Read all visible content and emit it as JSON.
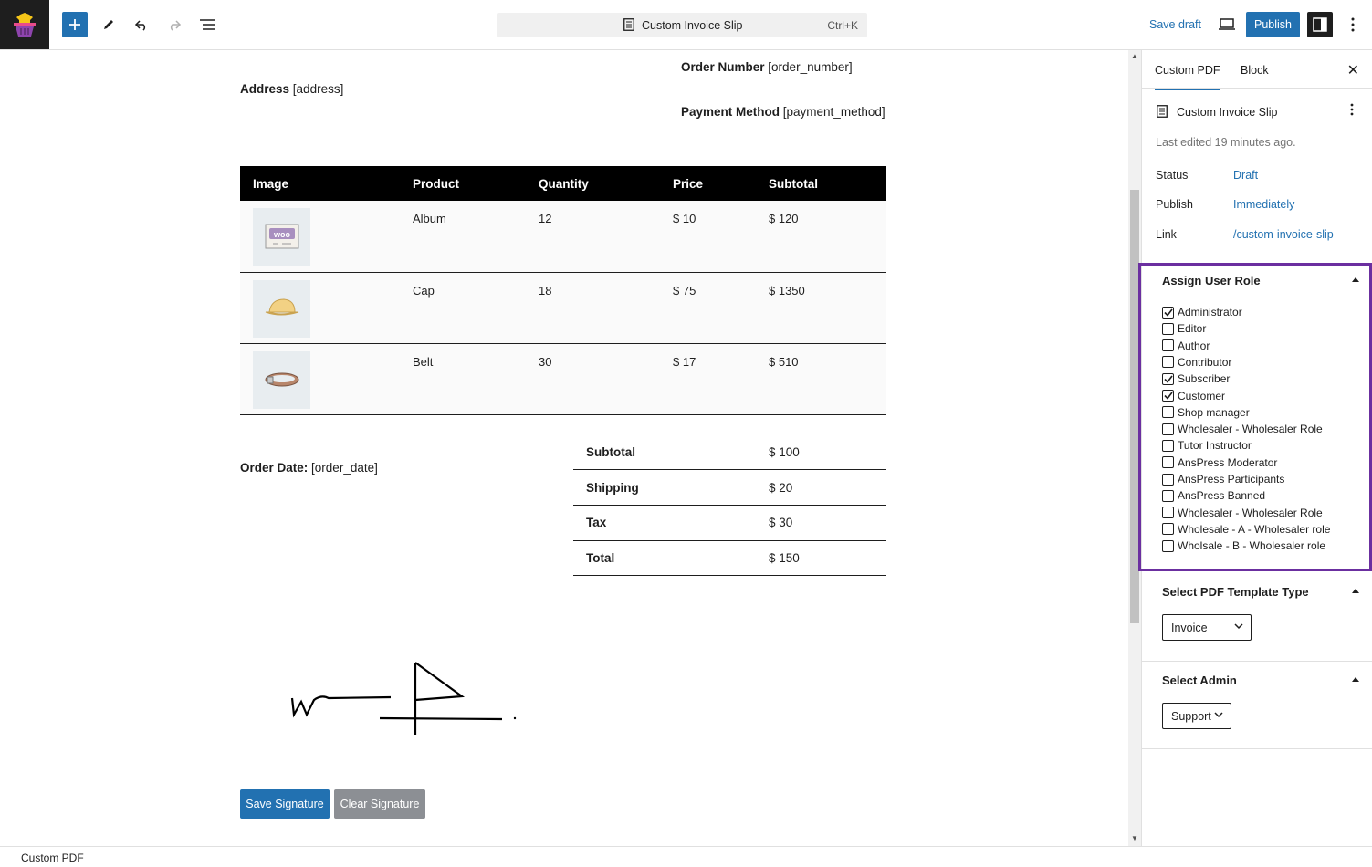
{
  "topbar": {
    "document_title": "Custom Invoice Slip",
    "shortcut": "Ctrl+K",
    "save_draft": "Save draft",
    "publish": "Publish"
  },
  "document": {
    "order_number_label": "Order Number",
    "order_number_value": "[order_number]",
    "address_label": "Address",
    "address_value": "[address]",
    "payment_method_label": "Payment Method",
    "payment_method_value": "[payment_method]",
    "order_date_label": "Order Date:",
    "order_date_value": "[order_date]",
    "table_headers": [
      "Image",
      "Product",
      "Quantity",
      "Price",
      "Subtotal"
    ],
    "items": [
      {
        "product": "Album",
        "quantity": "12",
        "price": "$ 10",
        "subtotal": "$ 120",
        "image": "woo-album-icon"
      },
      {
        "product": "Cap",
        "quantity": "18",
        "price": "$ 75",
        "subtotal": "$ 1350",
        "image": "cap-icon"
      },
      {
        "product": "Belt",
        "quantity": "30",
        "price": "$ 17",
        "subtotal": "$ 510",
        "image": "belt-icon"
      }
    ],
    "totals": [
      {
        "label": "Subtotal",
        "value": "$ 100"
      },
      {
        "label": "Shipping",
        "value": "$ 20"
      },
      {
        "label": "Tax",
        "value": "$ 30"
      },
      {
        "label": "Total",
        "value": "$ 150"
      }
    ],
    "save_signature": "Save Signature",
    "clear_signature": "Clear Signature"
  },
  "sidebar": {
    "tab_custom_pdf": "Custom PDF",
    "tab_block": "Block",
    "doc_title": "Custom Invoice Slip",
    "last_edited": "Last edited 19 minutes ago.",
    "status_label": "Status",
    "status_value": "Draft",
    "publish_label": "Publish",
    "publish_value": "Immediately",
    "link_label": "Link",
    "link_value": "/custom-invoice-slip",
    "assign_role_title": "Assign User Role",
    "roles": [
      {
        "label": "Administrator",
        "checked": true
      },
      {
        "label": "Editor",
        "checked": false
      },
      {
        "label": "Author",
        "checked": false
      },
      {
        "label": "Contributor",
        "checked": false
      },
      {
        "label": "Subscriber",
        "checked": true
      },
      {
        "label": "Customer",
        "checked": true
      },
      {
        "label": "Shop manager",
        "checked": false
      },
      {
        "label": "Wholesaler - Wholesaler Role",
        "checked": false
      },
      {
        "label": "Tutor Instructor",
        "checked": false
      },
      {
        "label": "AnsPress Moderator",
        "checked": false
      },
      {
        "label": "AnsPress Participants",
        "checked": false
      },
      {
        "label": "AnsPress Banned",
        "checked": false
      },
      {
        "label": "Wholesaler - Wholesaler Role",
        "checked": false
      },
      {
        "label": "Wholesale - A - Wholesaler role",
        "checked": false
      },
      {
        "label": "Wholsale - B - Wholesaler role",
        "checked": false
      }
    ],
    "template_type_title": "Select PDF Template Type",
    "template_type_value": "Invoice",
    "admin_title": "Select Admin",
    "admin_value": "Support"
  },
  "footer": {
    "breadcrumb": "Custom PDF"
  },
  "colors": {
    "accent": "#2271b1",
    "highlight_border": "#6b2fa0",
    "table_header_bg": "#000000",
    "clear_button_bg": "#8c8f94"
  }
}
